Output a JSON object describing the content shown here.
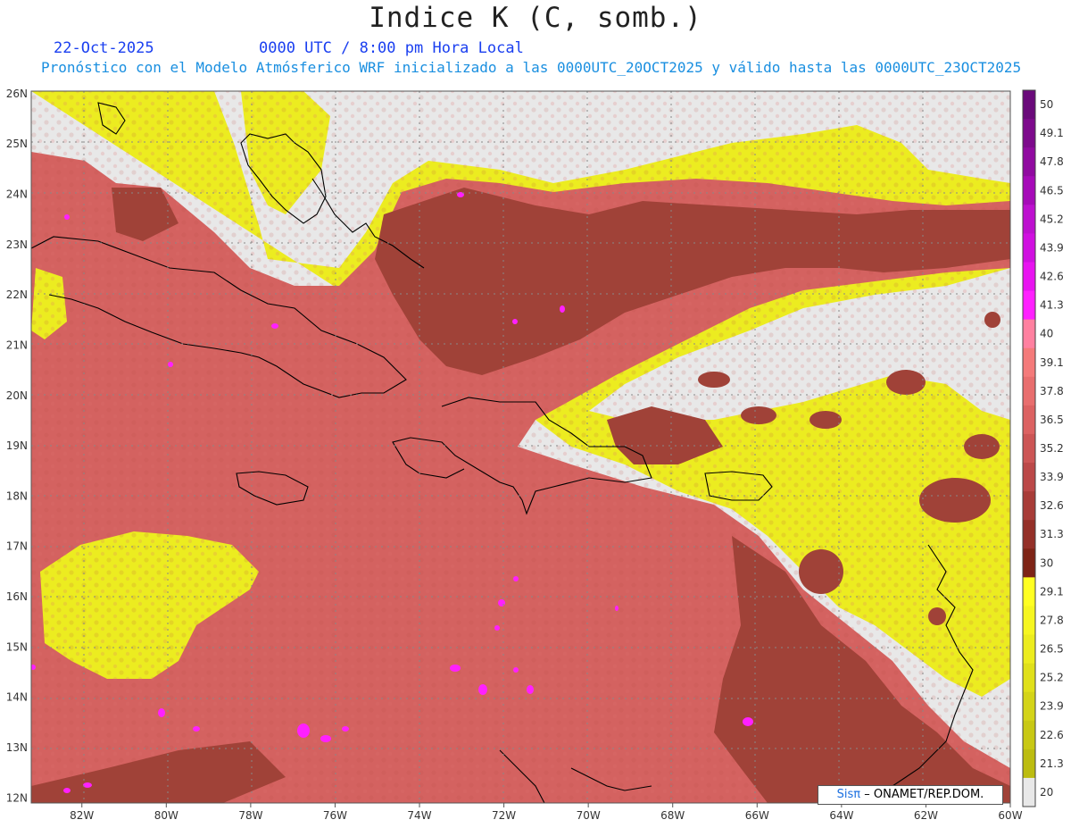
{
  "header": {
    "title": "Indice K (C, somb.)",
    "date": "22-Oct-2025",
    "time": "0000 UTC / 8:00 pm Hora Local",
    "description": "Pronóstico con el Modelo Atmósferico WRF inicializado a las 0000UTC_20OCT2025 y válido hasta las  0000UTC_23OCT2025"
  },
  "axes": {
    "lon_labels": [
      "82W",
      "80W",
      "78W",
      "76W",
      "74W",
      "72W",
      "70W",
      "68W",
      "66W",
      "64W",
      "62W",
      "60W"
    ],
    "lat_labels": [
      "26N",
      "25N",
      "24N",
      "23N",
      "22N",
      "21N",
      "20N",
      "19N",
      "18N",
      "17N",
      "16N",
      "15N",
      "14N",
      "13N",
      "12N"
    ],
    "lon_range": [
      -83.2,
      -60
    ],
    "lat_range": [
      11.9,
      26.05
    ]
  },
  "colorbar": {
    "labels": [
      "50",
      "49.1",
      "47.8",
      "46.5",
      "45.2",
      "43.9",
      "42.6",
      "41.3",
      "40",
      "39.1",
      "37.8",
      "36.5",
      "35.2",
      "33.9",
      "32.6",
      "31.3",
      "30",
      "29.1",
      "27.8",
      "26.5",
      "25.2",
      "23.9",
      "22.6",
      "21.3",
      "20"
    ],
    "colors": [
      "#6a0a7a",
      "#7d0a8c",
      "#900aa0",
      "#a60ab8",
      "#bd10cf",
      "#d010e0",
      "#e814f0",
      "#ff20ff",
      "#ff80a0",
      "#f47a7a",
      "#e86e6e",
      "#dc6262",
      "#cc5555",
      "#bb4848",
      "#a83c38",
      "#943028",
      "#7e2416",
      "#ffff22",
      "#f6f620",
      "#ecec1e",
      "#e0e01a",
      "#d4d418",
      "#c8c814",
      "#bcbc10",
      "#e8e8e8"
    ]
  },
  "colors": {
    "background_field": "#d46260",
    "high_field": "#a04238",
    "low_field": "#ecec20",
    "no_data": "#e8e8e8",
    "peak": "#ff20ff",
    "coast": "#000000"
  },
  "credit": {
    "logo": "Sisπ",
    "text": "– ONAMET/REP.DOM."
  }
}
